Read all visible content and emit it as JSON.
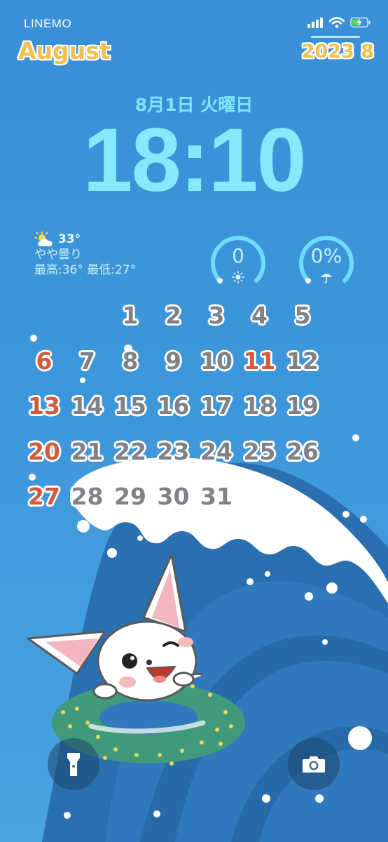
{
  "status_bar": {
    "carrier": "LINEMO",
    "signal_icon": "signal-bars-icon",
    "wifi_icon": "wifi-icon",
    "battery_icon": "battery-charging-icon"
  },
  "header": {
    "month_name": "August",
    "year_month": "2023 8"
  },
  "lock": {
    "date": "8月1日 火曜日",
    "time": "18:10"
  },
  "weather": {
    "icon": "partly-cloudy-icon",
    "temperature": "33°",
    "condition": "やや曇り",
    "high_low": "最高:36° 最低:27°"
  },
  "widgets": {
    "uv": {
      "value": "0",
      "icon": "sun-icon"
    },
    "rain": {
      "value": "0%",
      "icon": "umbrella-icon"
    }
  },
  "calendar": {
    "weeks": [
      [
        "",
        "",
        "1",
        "2",
        "3",
        "4",
        "5"
      ],
      [
        "6",
        "7",
        "8",
        "9",
        "10",
        "11",
        "12"
      ],
      [
        "13",
        "14",
        "15",
        "16",
        "17",
        "18",
        "19"
      ],
      [
        "20",
        "21",
        "22",
        "23",
        "24",
        "25",
        "26"
      ],
      [
        "27",
        "28",
        "29",
        "30",
        "31",
        "",
        ""
      ]
    ],
    "red_days": [
      "6",
      "11",
      "13",
      "20",
      "27"
    ]
  },
  "controls": {
    "flashlight_icon": "flashlight-icon",
    "camera_icon": "camera-icon"
  },
  "colors": {
    "background": "#3d96da",
    "clock": "#86eaff",
    "title_gold": "#f2c04f",
    "calendar_gray": "#7f8288",
    "calendar_red": "#d25a3d"
  }
}
